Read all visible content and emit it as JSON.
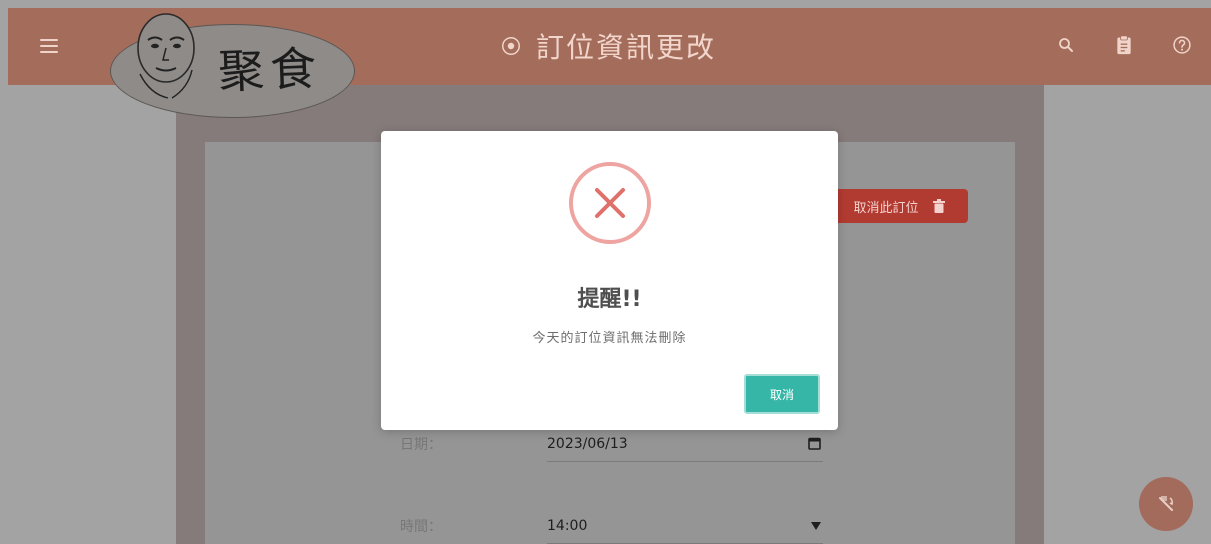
{
  "header": {
    "logo_text": "聚食",
    "title": "訂位資訊更改",
    "icons": [
      "menu-icon",
      "target-icon",
      "search-icon",
      "clipboard-icon",
      "help-icon"
    ]
  },
  "booking": {
    "cancel_label": "取消此訂位",
    "date_label": "日期：",
    "date_value": "2023/06/13",
    "time_label": "時間：",
    "time_value": "14:00"
  },
  "modal": {
    "title": "提醒!!",
    "message": "今天的訂位資訊無法刪除",
    "button_label": "取消"
  },
  "colors": {
    "appbar": "#a46c5b",
    "danger": "#b23b31",
    "accent": "#35b6a7",
    "error_icon": "#e0706a"
  }
}
